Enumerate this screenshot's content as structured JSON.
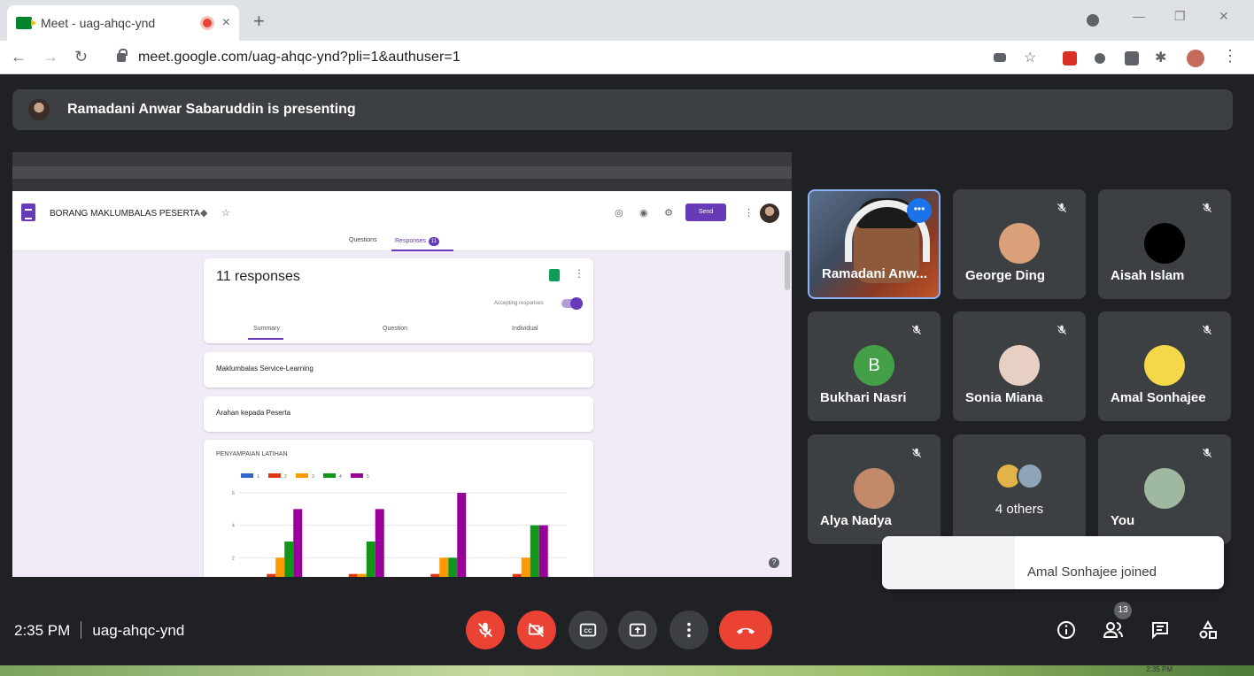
{
  "browser": {
    "tab_title": "Meet - uag-ahqc-ynd",
    "tab_close": "×",
    "new_tab": "+",
    "url": "meet.google.com/uag-ahqc-ynd?pli=1&authuser=1"
  },
  "banner": {
    "text": "Ramadani Anwar Sabaruddin is presenting"
  },
  "presentation": {
    "form_title": "BORANG MAKLUMBALAS PESERTA",
    "send_label": "Send",
    "tabs": [
      "Questions",
      "Responses"
    ],
    "responses_badge": "11",
    "responses_title": "11 responses",
    "accepting_label": "Accepting responses",
    "subtabs": [
      "Summary",
      "Question",
      "Individual"
    ],
    "section1": "Maklumbalas Service-Learning",
    "section2": "Arahan kepada Peserta",
    "chart_title": "PENYAMPAIAN LATIHAN"
  },
  "chart_data": {
    "type": "bar",
    "title": "PENYAMPAIAN LATIHAN",
    "categories": [
      "",
      "",
      "",
      ""
    ],
    "series": [
      {
        "name": "1",
        "values": [
          0,
          0,
          0,
          0
        ]
      },
      {
        "name": "2",
        "values": [
          1,
          1,
          1,
          1
        ]
      },
      {
        "name": "3",
        "values": [
          2,
          1,
          2,
          2
        ]
      },
      {
        "name": "4",
        "values": [
          3,
          3,
          2,
          4
        ]
      },
      {
        "name": "5",
        "values": [
          5,
          5,
          6,
          4
        ]
      }
    ],
    "yticks": [
      "6",
      "4",
      "2"
    ],
    "ylim": [
      0,
      6
    ],
    "colors": [
      "#3366cc",
      "#dc3912",
      "#ff9900",
      "#109618",
      "#990099"
    ]
  },
  "participants": [
    {
      "name": "Ramadani Anw...",
      "type": "video"
    },
    {
      "name": "George Ding",
      "type": "photo",
      "color": "#d9a07a"
    },
    {
      "name": "Aisah Islam",
      "type": "photo",
      "color": "#000000"
    },
    {
      "name": "Bukhari Nasri",
      "type": "letter",
      "letter": "B",
      "color": "#43a047"
    },
    {
      "name": "Sonia Miana",
      "type": "photo",
      "color": "#e8cfc4"
    },
    {
      "name": "Amal Sonhajee",
      "type": "photo",
      "color": "#f5d84a"
    },
    {
      "name": "Alya Nadya",
      "type": "photo",
      "color": "#c28a6a"
    },
    {
      "name": "4 others",
      "type": "others"
    },
    {
      "name": "You",
      "type": "photo",
      "color": "#9fb8a0"
    }
  ],
  "toast": {
    "text": "Amal Sonhajee joined"
  },
  "bottom_bar": {
    "time": "2:35 PM",
    "meeting_code": "uag-ahqc-ynd",
    "participant_count": "13"
  },
  "colors": {
    "meet_bg": "#202124",
    "tile_bg": "#3c4043",
    "danger": "#ea4335",
    "forms_purple": "#673ab7"
  }
}
